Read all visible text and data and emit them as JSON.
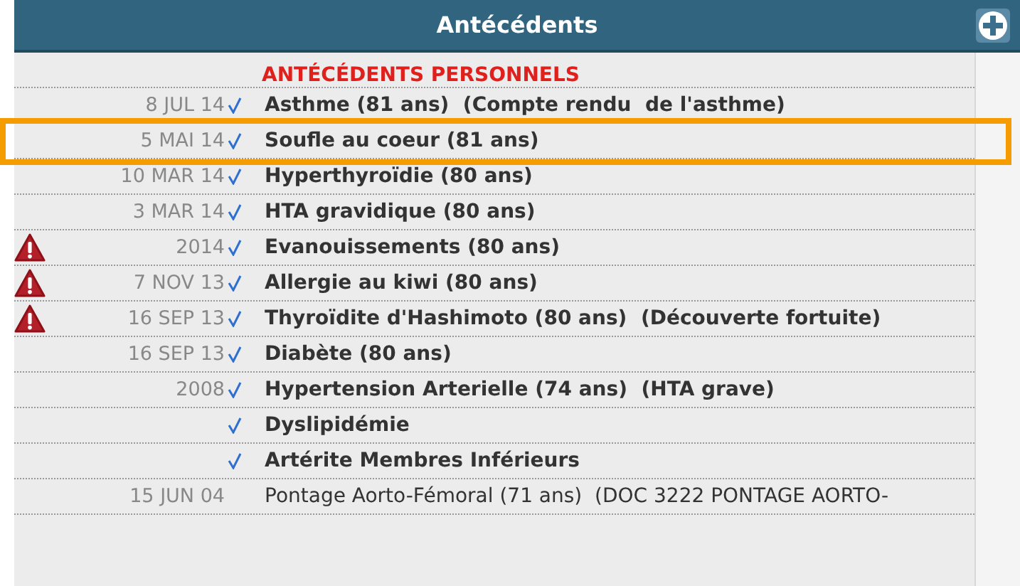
{
  "panel": {
    "title": "Antécédents",
    "add_button": true
  },
  "section": {
    "title": "ANTÉCÉDENTS PERSONNELS"
  },
  "rows": [
    {
      "date": "8 JUL 14",
      "checked": true,
      "text": "Asthme (81 ans)  (Compte rendu  de l'asthme)",
      "bold": true,
      "warning": false,
      "selected": false
    },
    {
      "date": "5 MAI 14",
      "checked": true,
      "text": "Soufle au coeur (81 ans)",
      "bold": true,
      "warning": false,
      "selected": true
    },
    {
      "date": "10 MAR 14",
      "checked": true,
      "text": "Hyperthyroïdie (80 ans)",
      "bold": true,
      "warning": false,
      "selected": false
    },
    {
      "date": "3 MAR 14",
      "checked": true,
      "text": "HTA gravidique (80 ans)",
      "bold": true,
      "warning": false,
      "selected": false
    },
    {
      "date": "2014",
      "checked": true,
      "text": "Evanouissements (80 ans)",
      "bold": true,
      "warning": true,
      "selected": false
    },
    {
      "date": "7 NOV 13",
      "checked": true,
      "text": "Allergie au kiwi (80 ans)",
      "bold": true,
      "warning": true,
      "selected": false
    },
    {
      "date": "16 SEP 13",
      "checked": true,
      "text": "Thyroïdite d'Hashimoto (80 ans)  (Découverte fortuite)",
      "bold": true,
      "warning": true,
      "selected": false
    },
    {
      "date": "16 SEP 13",
      "checked": true,
      "text": "Diabète (80 ans)",
      "bold": true,
      "warning": false,
      "selected": false
    },
    {
      "date": "2008",
      "checked": true,
      "text": "Hypertension Arterielle (74 ans)  (HTA grave)",
      "bold": true,
      "warning": false,
      "selected": false
    },
    {
      "checked": true,
      "text": "Dyslipidémie",
      "bold": true,
      "warning": false,
      "selected": false
    },
    {
      "checked": true,
      "text": "Artérite Membres Inférieurs",
      "bold": true,
      "warning": false,
      "selected": false
    },
    {
      "date": "15 JUN 04",
      "checked": false,
      "text": "Pontage Aorto-Fémoral (71 ans)  (DOC 3222 PONTAGE AORTO-",
      "bold": false,
      "warning": false,
      "selected": false
    }
  ]
}
